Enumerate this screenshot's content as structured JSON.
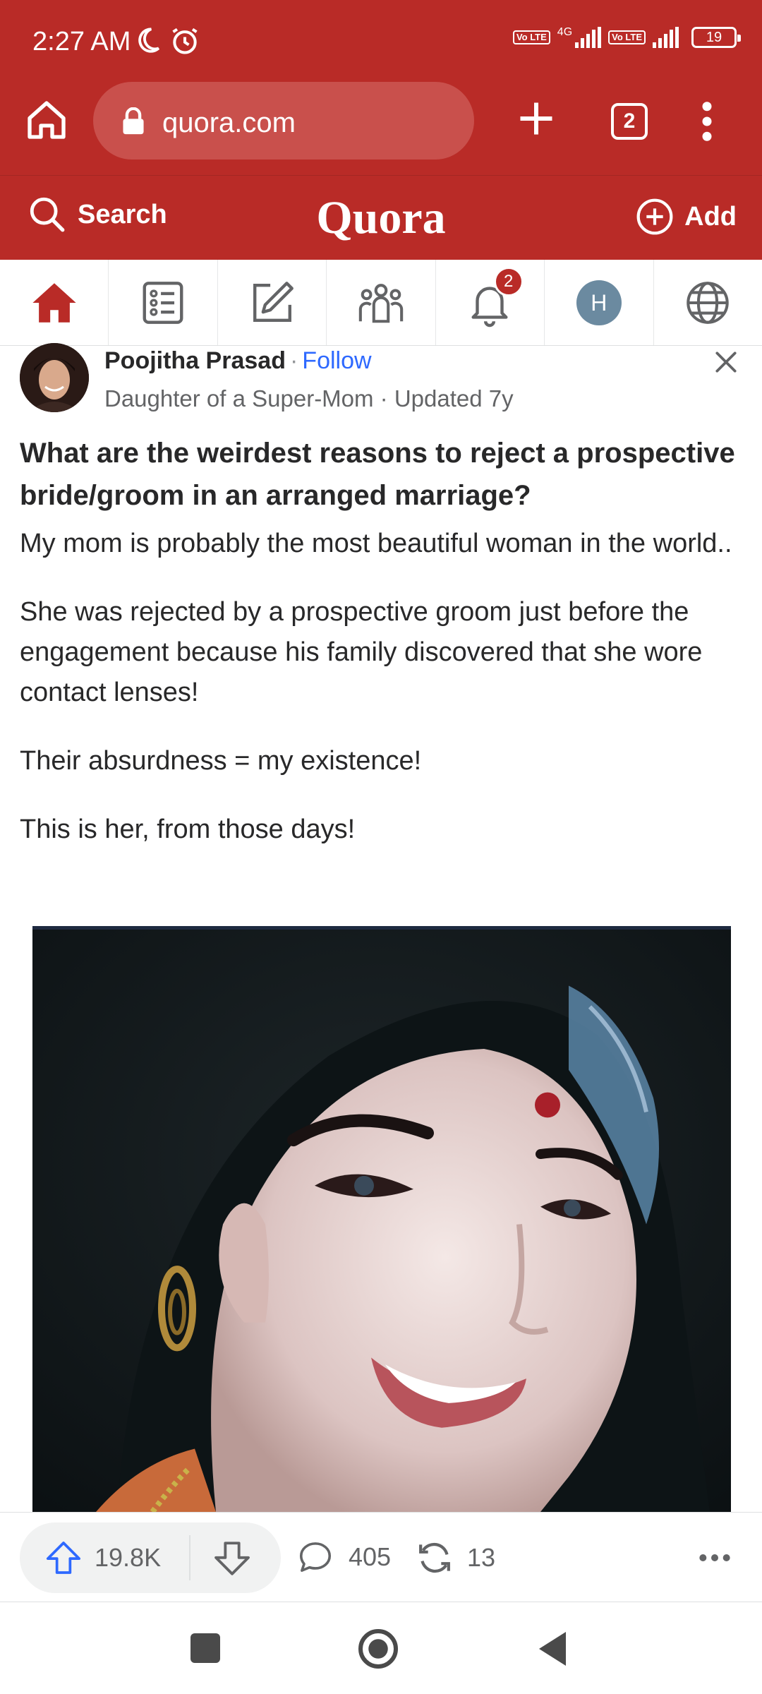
{
  "status_bar": {
    "time": "2:27 AM",
    "network_label": "4G",
    "lte_badge": "Vo LTE",
    "battery": "19"
  },
  "browser": {
    "url": "quora.com",
    "tab_count": "2"
  },
  "quora_header": {
    "search_label": "Search",
    "logo": "Quora",
    "add_label": "Add"
  },
  "nav": {
    "notification_count": "2",
    "profile_initial": "H"
  },
  "answer": {
    "author_name": "Poojitha Prasad",
    "separator": "·",
    "follow_label": "Follow",
    "credential": "Daughter of a Super-Mom · Updated 7y",
    "question": "What are the weirdest reasons to reject a prospective bride/groom in an arranged marriage?",
    "paragraphs": [
      "My mom is probably the most beautiful woman in the world..",
      "She was rejected by a prospective groom just before the engagement because his family discovered that she wore contact lenses!",
      "Their absurdness = my existence!",
      "This is her, from those days!"
    ]
  },
  "actions": {
    "upvotes": "19.8K",
    "comments": "405",
    "shares": "13"
  },
  "colors": {
    "brand": "#b92b27",
    "link": "#2e69ff",
    "text": "#282829",
    "muted": "#636466"
  }
}
